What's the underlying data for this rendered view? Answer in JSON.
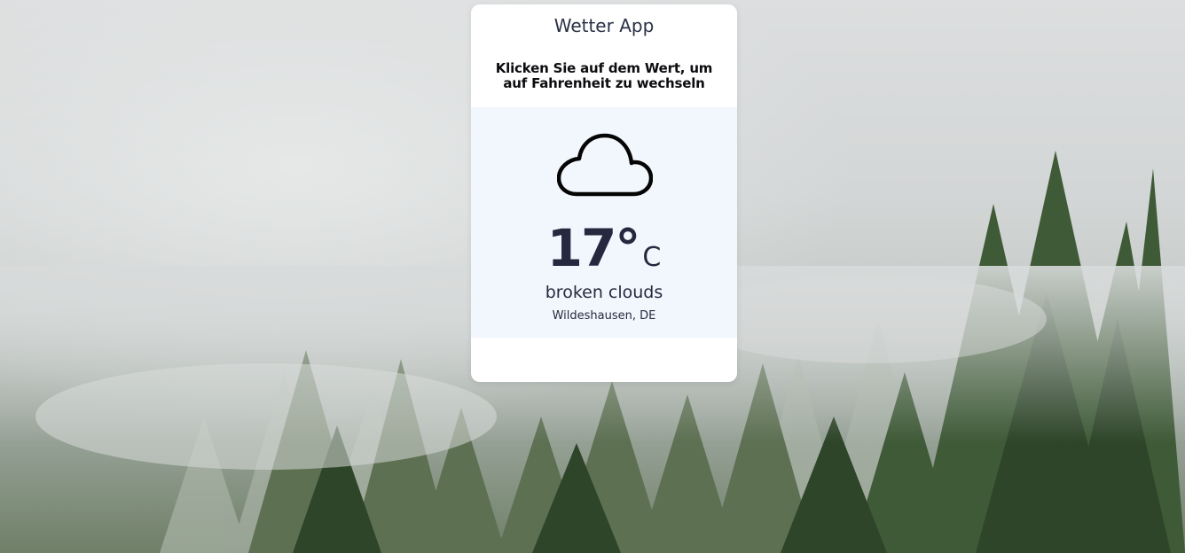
{
  "app": {
    "title": "Wetter App",
    "hint": "Klicken Sie auf dem Wert, um auf Fahrenheit zu wechseln"
  },
  "weather": {
    "icon": "cloud-icon",
    "temperature": "17°",
    "unit": "C",
    "description": "broken clouds",
    "location": "Wildeshausen, DE"
  },
  "colors": {
    "card": "#ffffff",
    "panel": "#f2f7fd",
    "text": "#25293f"
  }
}
